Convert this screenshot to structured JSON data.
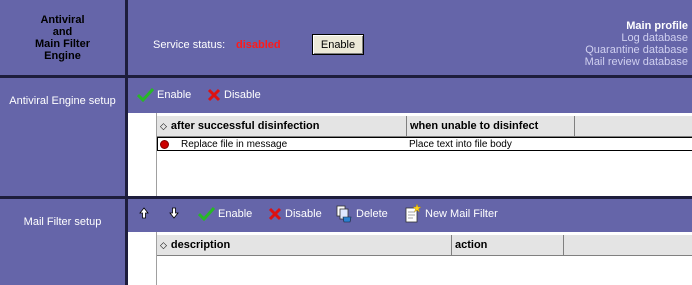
{
  "header": {
    "title_lines": [
      "Antiviral",
      "and",
      "Main Filter",
      "Engine"
    ],
    "service_status_label": "Service status:",
    "service_status_value": "disabled",
    "enable_button_label": "Enable",
    "profile": {
      "main": "Main profile",
      "links": [
        "Log database",
        "Quarantine database",
        "Mail review database"
      ]
    }
  },
  "antiviral_section": {
    "label": "Antiviral Engine setup",
    "toolbar": {
      "enable_label": "Enable",
      "disable_label": "Disable"
    },
    "columns": [
      "after successful disinfection",
      "when unable to disinfect"
    ],
    "rows": [
      {
        "after": "Replace file in message",
        "unable": "Place text into file body"
      }
    ]
  },
  "mail_filter_section": {
    "label": "Mail Filter setup",
    "toolbar": {
      "enable_label": "Enable",
      "disable_label": "Disable",
      "delete_label": "Delete",
      "new_label": "New Mail Filter"
    },
    "columns": [
      "description",
      "action"
    ]
  },
  "colors": {
    "panel": "#6565a9",
    "status_disabled": "#ff1a1a",
    "divider": "#1d1d3c"
  }
}
